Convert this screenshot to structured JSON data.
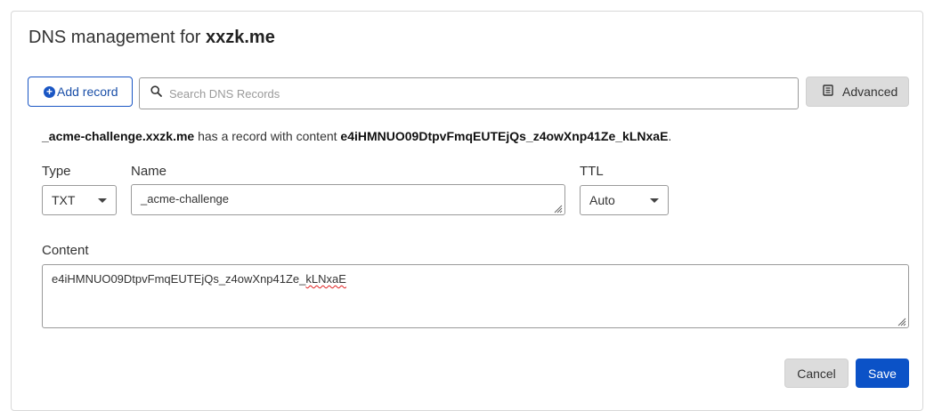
{
  "header": {
    "title_prefix": "DNS management for",
    "domain": "xxzk.me"
  },
  "toolbar": {
    "add_record_label": "Add record",
    "search_placeholder": "Search DNS Records",
    "advanced_label": "Advanced"
  },
  "summary": {
    "record_name": "_acme-challenge.xxzk.me",
    "middle_text": "has a record with content",
    "content": "e4iHMNUO09DtpvFmqEUTEjQs_z4owXnp41Ze_kLNxaE",
    "end": "."
  },
  "form": {
    "type_label": "Type",
    "type_value": "TXT",
    "name_label": "Name",
    "name_value": "_acme-challenge",
    "ttl_label": "TTL",
    "ttl_value": "Auto",
    "content_label": "Content",
    "content_prefix": "e4iHMNUO09DtpvFmqEUTEjQs_z4owXnp41Ze_",
    "content_misspelled": "kLNxaE"
  },
  "actions": {
    "cancel_label": "Cancel",
    "save_label": "Save"
  },
  "colors": {
    "accent": "#0b52c7",
    "misspelling_underline": "#e02020"
  },
  "icons": {
    "add": "plus-circle-icon",
    "search": "search-icon",
    "advanced": "book-icon",
    "dropdown": "chevron-down-icon",
    "resize": "resize-grip-icon"
  }
}
